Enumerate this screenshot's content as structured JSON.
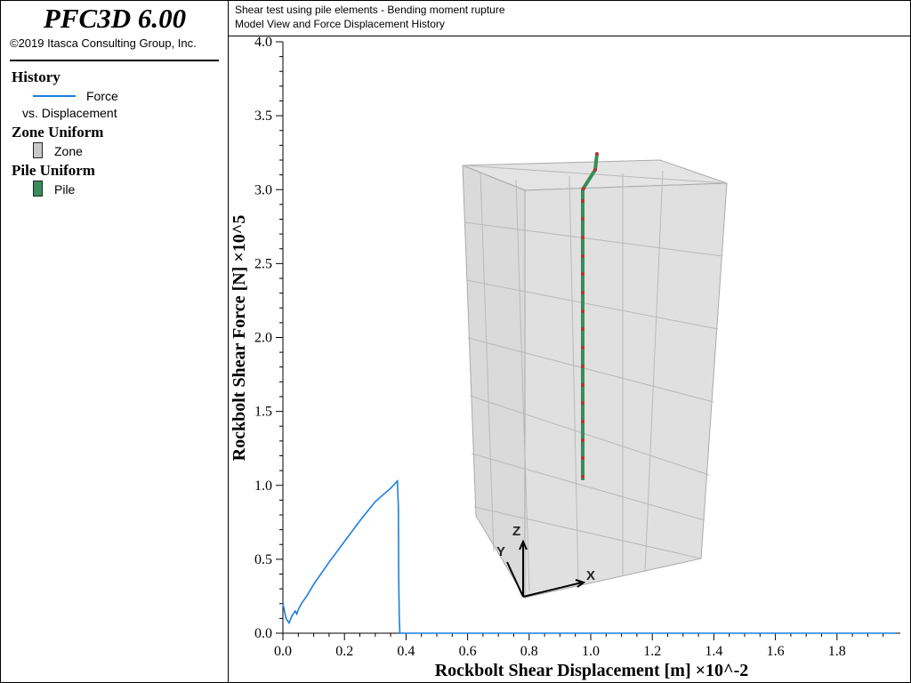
{
  "app": {
    "title": "PFC3D 6.00",
    "copyright": "©2019 Itasca Consulting Group, Inc."
  },
  "legend": {
    "history_heading": "History",
    "history_item_label": "Force",
    "history_item_sub": "vs. Displacement",
    "history_color": "#1a7fe0",
    "zone_heading": "Zone Uniform",
    "zone_item": "Zone",
    "zone_color": "#c8c8c8",
    "pile_heading": "Pile Uniform",
    "pile_item": "Pile",
    "pile_color": "#3a8c5a"
  },
  "description": {
    "line1": "Shear test using pile elements - Bending moment rupture",
    "line2": "Model View and Force Displacement History"
  },
  "triad": {
    "x_label": "X",
    "y_label": "Y",
    "z_label": "Z"
  },
  "chart_data": {
    "type": "line",
    "xlabel": "Rockbolt Shear Displacement [m] ×10^-2",
    "ylabel": "Rockbolt Shear Force [N] ×10^5",
    "xlim": [
      0.0,
      2.0
    ],
    "ylim": [
      0.0,
      4.0
    ],
    "x_ticks": [
      "0.0",
      "0.2",
      "0.4",
      "0.6",
      "0.8",
      "1.0",
      "1.2",
      "1.4",
      "1.6",
      "1.8"
    ],
    "y_ticks": [
      "0.0",
      "0.5",
      "1.0",
      "1.5",
      "2.0",
      "2.5",
      "3.0",
      "3.5",
      "4.0"
    ],
    "series": [
      {
        "name": "Force vs. Displacement",
        "color": "#1a7fe0",
        "x": [
          0.0,
          0.01,
          0.02,
          0.03,
          0.04,
          0.045,
          0.05,
          0.06,
          0.08,
          0.1,
          0.15,
          0.2,
          0.25,
          0.3,
          0.35,
          0.372,
          0.375,
          0.376,
          0.378,
          0.38,
          0.4,
          0.5,
          0.6,
          0.8,
          1.0,
          1.2,
          1.4,
          1.6,
          1.8,
          1.99
        ],
        "y": [
          0.2,
          0.1,
          0.07,
          0.12,
          0.15,
          0.13,
          0.16,
          0.2,
          0.26,
          0.33,
          0.48,
          0.62,
          0.76,
          0.89,
          0.98,
          1.03,
          0.85,
          0.4,
          0.1,
          0.0,
          0.0,
          0.0,
          0.0,
          0.0,
          0.0,
          0.0,
          0.0,
          0.0,
          0.0,
          0.0
        ]
      }
    ],
    "grid": false
  }
}
